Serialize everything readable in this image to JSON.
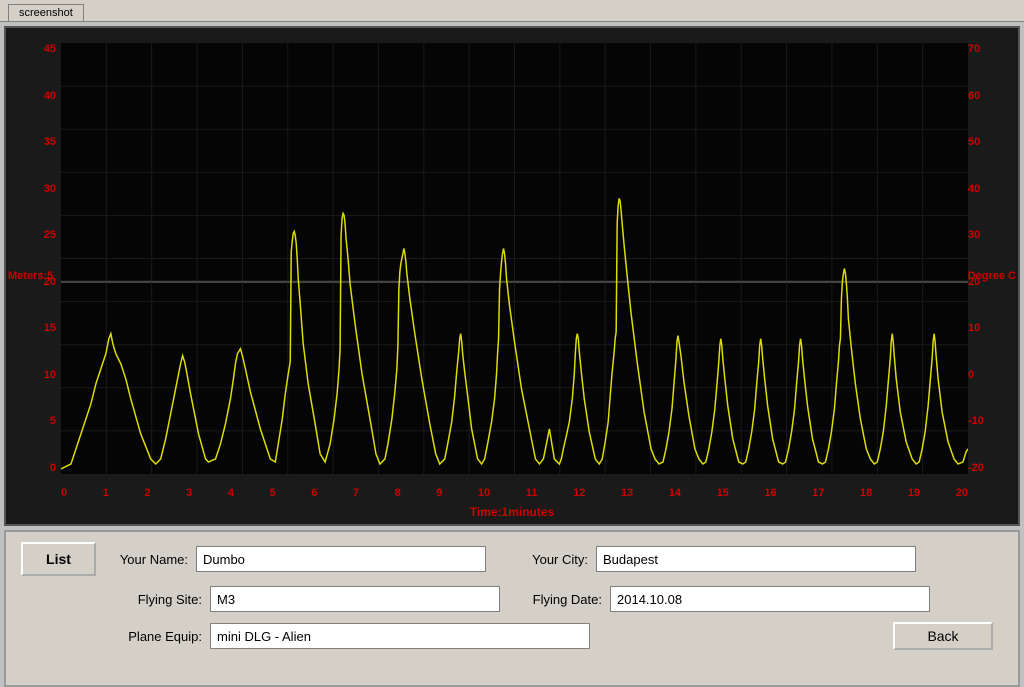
{
  "tab": {
    "label": "screenshot"
  },
  "chart": {
    "y_left_axis_label": "Meters:5",
    "y_right_axis_label": "Degree C",
    "x_axis_label": "Time:1minutes",
    "y_left_ticks": [
      "45",
      "40",
      "35",
      "30",
      "25",
      "20",
      "15",
      "10",
      "5",
      "0"
    ],
    "y_right_ticks": [
      "70",
      "60",
      "50",
      "40",
      "30",
      "20",
      "10",
      "0",
      "-10",
      "-20"
    ],
    "x_ticks": [
      "0",
      "1",
      "2",
      "3",
      "4",
      "5",
      "6",
      "7",
      "8",
      "9",
      "10",
      "11",
      "12",
      "13",
      "14",
      "15",
      "16",
      "17",
      "18",
      "19",
      "20"
    ],
    "background_color": "#0a0a0a",
    "line_color": "#dddd00",
    "grid_color": "#222"
  },
  "form": {
    "list_button_label": "List",
    "back_button_label": "Back",
    "your_name_label": "Your Name:",
    "your_name_value": "Dumbo",
    "your_city_label": "Your City:",
    "your_city_value": "Budapest",
    "flying_site_label": "Flying Site:",
    "flying_site_value": "M3",
    "flying_date_label": "Flying Date:",
    "flying_date_value": "2014.10.08",
    "plane_equip_label": "Plane Equip:",
    "plane_equip_value": "mini DLG - Alien"
  }
}
